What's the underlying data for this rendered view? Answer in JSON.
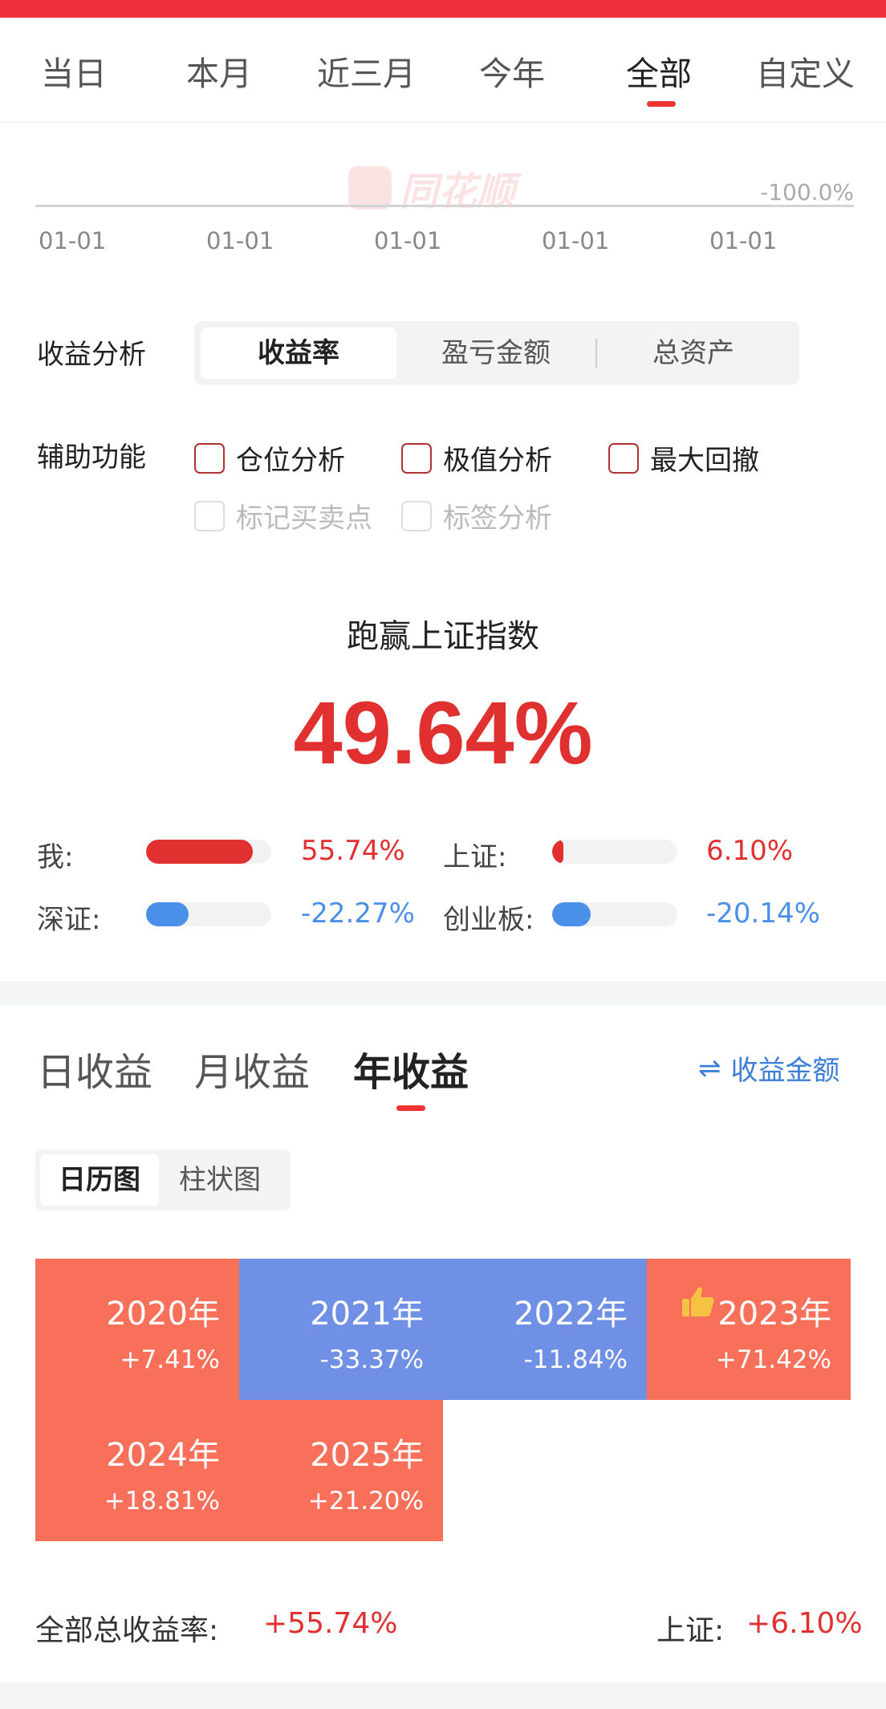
{
  "period_tabs": [
    "当日",
    "本月",
    "近三月",
    "今年",
    "全部",
    "自定义"
  ],
  "chart": {
    "watermark": "同花顺",
    "y_label": "-100.0%",
    "x_ticks": [
      "01-01",
      "01-01",
      "01-01",
      "01-01",
      "01-01"
    ]
  },
  "analysis": {
    "label": "收益分析",
    "options": [
      "收益率",
      "盈亏金额",
      "总资产"
    ],
    "selected": "收益率"
  },
  "aux": {
    "label": "辅助功能",
    "options": [
      "仓位分析",
      "极值分析",
      "最大回撤",
      "标记买卖点",
      "标签分析"
    ]
  },
  "beat": {
    "title": "跑赢上证指数",
    "value": "49.64%"
  },
  "comparison": [
    {
      "label": "我:",
      "value": "55.74%",
      "fill": 0.85,
      "color": "#e03030"
    },
    {
      "label": "上证:",
      "value": "6.10%",
      "fill": 0.09,
      "color": "#e03030"
    },
    {
      "label": "深证:",
      "value": "-22.27%",
      "fill": 0.34,
      "color": "#4a90e8"
    },
    {
      "label": "创业板:",
      "value": "-20.14%",
      "fill": 0.31,
      "color": "#4a90e8"
    }
  ],
  "yield_tabs": [
    "日收益",
    "月收益",
    "年收益"
  ],
  "switch_link": "收益金额",
  "view_toggle": [
    "日历图",
    "柱状图"
  ],
  "years": [
    {
      "year": "2020年",
      "ret": "+7.41%",
      "color": "#f8705a"
    },
    {
      "year": "2021年",
      "ret": "-33.37%",
      "color": "#6f90e4"
    },
    {
      "year": "2022年",
      "ret": "-11.84%",
      "color": "#6f90e4"
    },
    {
      "year": "2023年",
      "ret": "+71.42%",
      "color": "#f8705a"
    },
    {
      "year": "2024年",
      "ret": "+18.81%",
      "color": "#f8705a"
    },
    {
      "year": "2025年",
      "ret": "+21.20%",
      "color": "#f8705a"
    }
  ],
  "summary": {
    "total_label": "全部总收益率:",
    "total_value": "+55.74%",
    "sh_label": "上证:",
    "sh_value": "+6.10%"
  }
}
